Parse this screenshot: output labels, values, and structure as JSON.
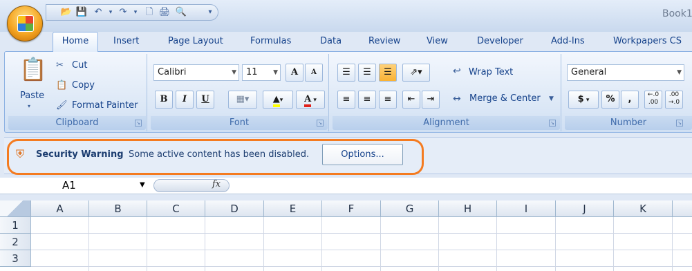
{
  "window": {
    "doc_title": "Book1"
  },
  "tabs": [
    {
      "label": "Home"
    },
    {
      "label": "Insert"
    },
    {
      "label": "Page Layout"
    },
    {
      "label": "Formulas"
    },
    {
      "label": "Data"
    },
    {
      "label": "Review"
    },
    {
      "label": "View"
    },
    {
      "label": "Developer"
    },
    {
      "label": "Add-Ins"
    },
    {
      "label": "Workpapers CS"
    }
  ],
  "clipboard": {
    "paste": "Paste",
    "cut": "Cut",
    "copy": "Copy",
    "format_painter": "Format Painter",
    "label": "Clipboard"
  },
  "font": {
    "name": "Calibri",
    "size": "11",
    "grow": "A",
    "shrink": "A",
    "bold": "B",
    "italic": "I",
    "underline": "U",
    "font_color": "A",
    "label": "Font"
  },
  "alignment": {
    "wrap_text": "Wrap Text",
    "merge_center": "Merge & Center",
    "label": "Alignment"
  },
  "number": {
    "format": "General",
    "currency": "$",
    "percent": "%",
    "comma": ",",
    "increase_decimal": "←.0 .00",
    "decrease_decimal": ".00 →.0",
    "label": "Number"
  },
  "security": {
    "title": "Security Warning",
    "message": "Some active content has been disabled.",
    "options_label": "Options..."
  },
  "formula_bar": {
    "cell_ref": "A1",
    "fx": "fx"
  },
  "grid": {
    "columns": [
      "A",
      "B",
      "C",
      "D",
      "E",
      "F",
      "G",
      "H",
      "I",
      "J",
      "K"
    ],
    "rows": [
      "1",
      "2",
      "3"
    ]
  },
  "colors": {
    "highlight_oval": "#f47b20",
    "accent": "#15428b"
  },
  "icons": [
    "office-button-icon",
    "save-icon",
    "undo-icon",
    "redo-icon",
    "new-icon",
    "print-icon",
    "print-preview-icon",
    "paste-icon",
    "cut-icon",
    "copy-icon",
    "format-painter-icon",
    "shield-icon",
    "fx-icon"
  ]
}
